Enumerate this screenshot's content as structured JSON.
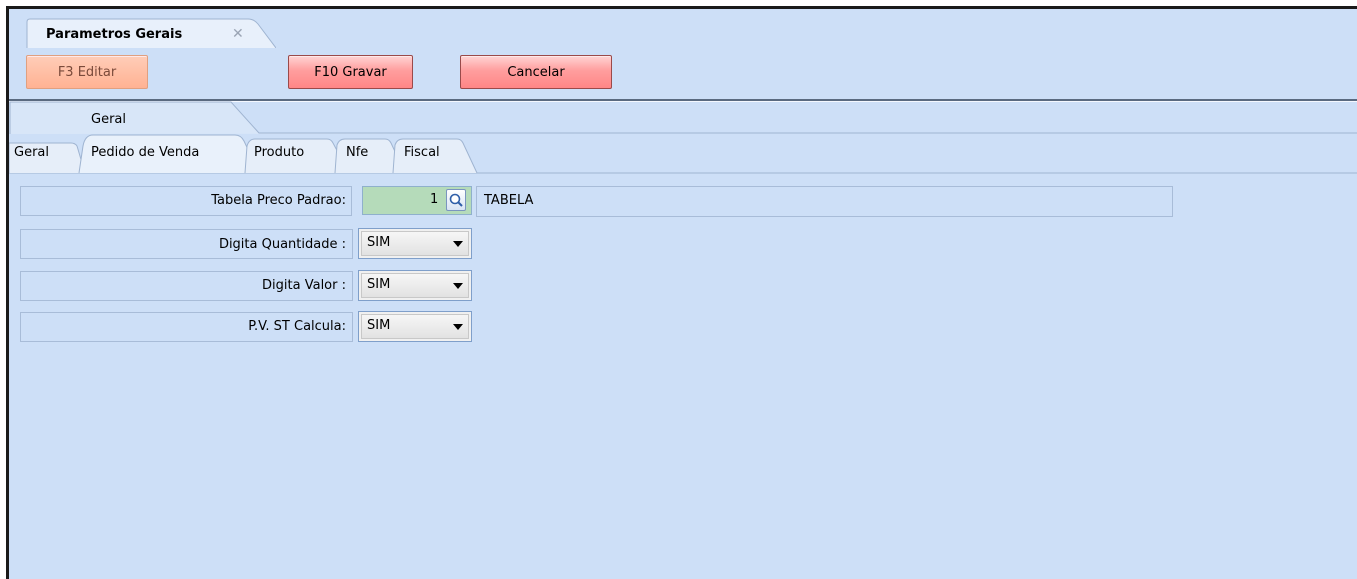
{
  "document_tab": {
    "title": "Parametros Gerais",
    "close_symbol": "✕"
  },
  "toolbar": {
    "edit_label": "F3 Editar",
    "save_label": "F10 Gravar",
    "cancel_label": "Cancelar"
  },
  "group_tab": {
    "label": "Geral"
  },
  "tabs": [
    {
      "label": "Geral"
    },
    {
      "label": "Pedido de Venda"
    },
    {
      "label": "Produto"
    },
    {
      "label": "Nfe"
    },
    {
      "label": "Fiscal"
    }
  ],
  "form": {
    "tabela_preco": {
      "label": "Tabela Preco Padrao:",
      "value": "1",
      "description": "TABELA"
    },
    "digita_quantidade": {
      "label": "Digita Quantidade :",
      "value": "SIM"
    },
    "digita_valor": {
      "label": "Digita Valor :",
      "value": "SIM"
    },
    "pv_st_calcula": {
      "label": "P.V. ST Calcula:",
      "value": "SIM"
    }
  },
  "colors": {
    "background": "#cddff7",
    "button_gradient_bottom": "#ff8686",
    "field_highlight": "#b5dbba"
  }
}
